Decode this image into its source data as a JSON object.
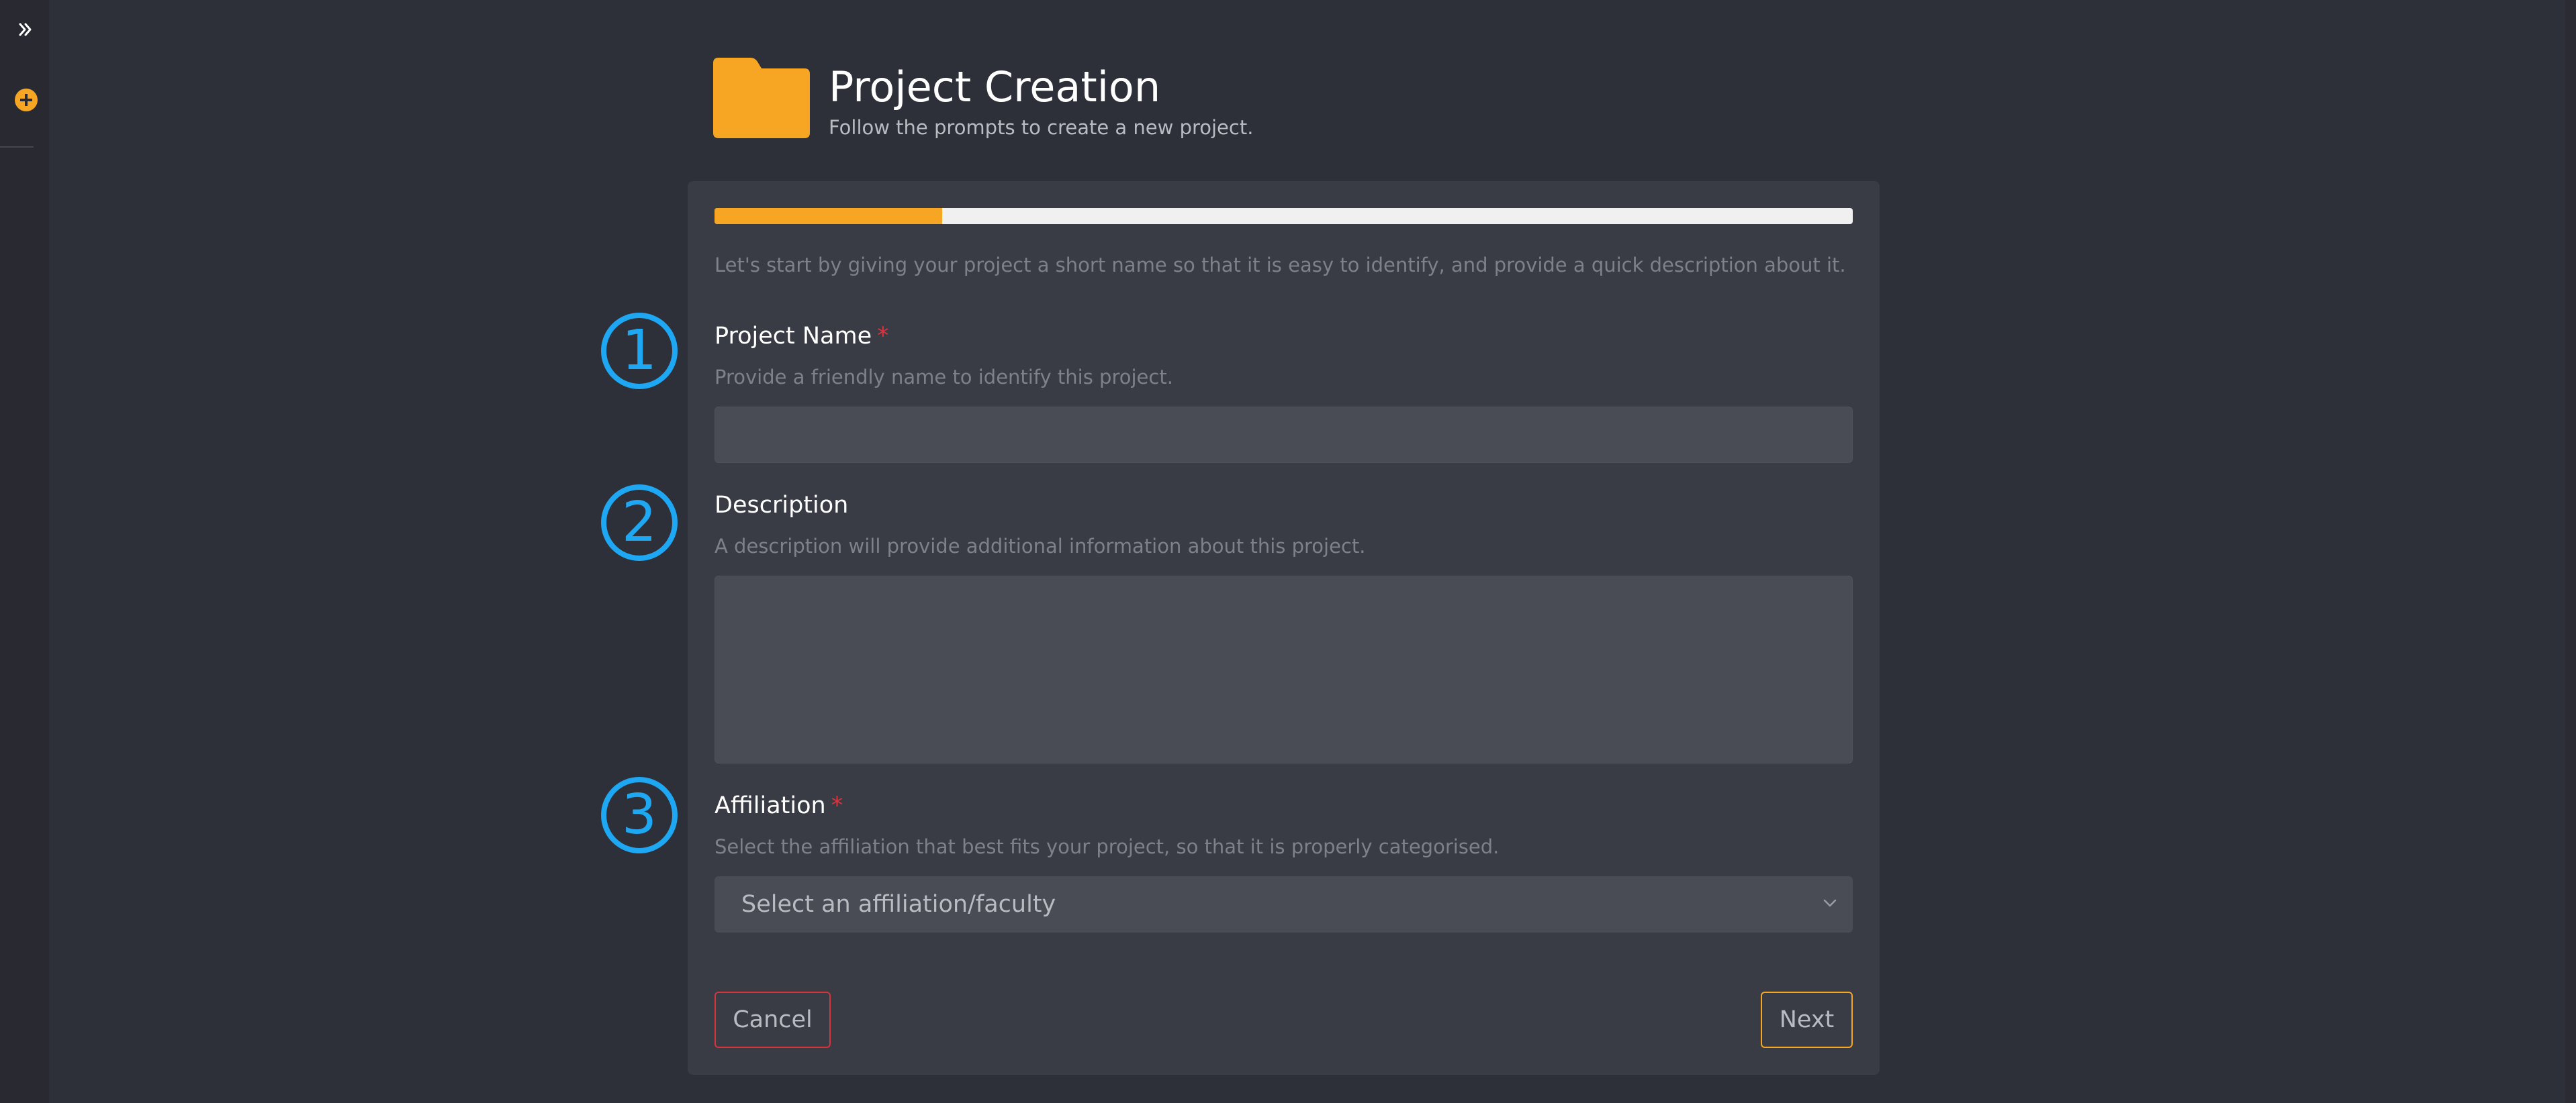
{
  "sidebar": {
    "expand_icon": "double-chevron-right-icon",
    "add_icon": "plus-circle-icon"
  },
  "header": {
    "icon": "folder-icon",
    "title": "Project Creation",
    "subtitle": "Follow the prompts to create a new project."
  },
  "progress": {
    "fraction": 0.2
  },
  "intro": "Let's start by giving your project a short name so that it is easy to identify, and provide a quick description about it.",
  "fields": {
    "project_name": {
      "label": "Project Name",
      "required": "*",
      "help": "Provide a friendly name to identify this project.",
      "value": ""
    },
    "description": {
      "label": "Description",
      "help": "A description will provide additional information about this project.",
      "value": ""
    },
    "affiliation": {
      "label": "Affiliation",
      "required": "*",
      "help": "Select the affiliation that best fits your project, so that it is properly categorised.",
      "selected": "Select an affiliation/faculty"
    }
  },
  "buttons": {
    "cancel": "Cancel",
    "next": "Next"
  },
  "steps": [
    "1",
    "2",
    "3"
  ],
  "colors": {
    "accent": "#f6a623",
    "danger": "#e0323b",
    "marker": "#1ea7f2",
    "background": "#2e3039",
    "panel": "#393b45"
  }
}
